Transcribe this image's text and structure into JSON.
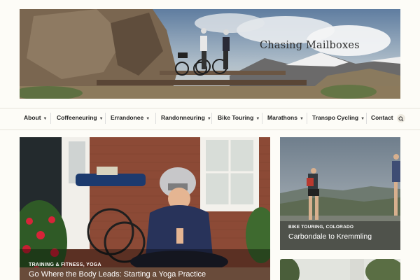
{
  "site": {
    "title": "Chasing Mailboxes"
  },
  "nav": {
    "items": [
      {
        "label": "About",
        "has_dropdown": true
      },
      {
        "label": "Coffeeneuring",
        "has_dropdown": true
      },
      {
        "label": "Errandonee",
        "has_dropdown": true
      },
      {
        "label": "Randonneuring",
        "has_dropdown": true
      },
      {
        "label": "Bike Touring",
        "has_dropdown": true
      },
      {
        "label": "Marathons",
        "has_dropdown": true
      },
      {
        "label": "Transpo Cycling",
        "has_dropdown": true
      },
      {
        "label": "Contact",
        "has_dropdown": false
      }
    ],
    "search_icon": "search-icon",
    "chevron_icon": "chevron-down-icon"
  },
  "posts": {
    "featured": {
      "categories": "Training & Fitness, Yoga",
      "title": "Go Where the Body Leads: Starting a Yoga Practice"
    },
    "side": {
      "categories": "Bike Touring, Colorado",
      "title": "Carbondale to Kremmling"
    }
  },
  "colors": {
    "page_background": "#fdfcf7",
    "nav_text": "#222222",
    "overlay_text": "#ffffff"
  }
}
